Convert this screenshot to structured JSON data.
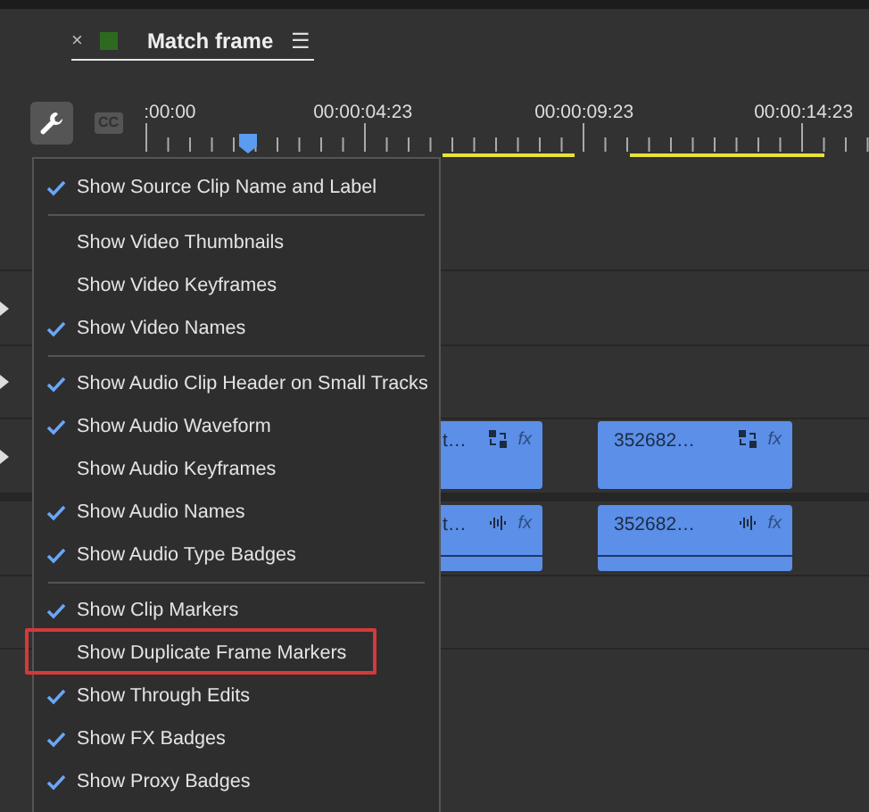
{
  "panel_tab": {
    "close": "×",
    "label": "Match frame",
    "menu": "☰",
    "selected": true,
    "color": "#2d6a1e"
  },
  "toolbar": {
    "captions": "CC"
  },
  "ruler": {
    "timecodes": [
      ":00:00",
      "00:00:04:23",
      "00:00:09:23",
      "00:00:14:23"
    ]
  },
  "video_clips": [
    {
      "name": "t…",
      "fx": "fx"
    },
    {
      "name": "352682…",
      "fx": "fx"
    }
  ],
  "audio_clips": [
    {
      "name": "t…",
      "fx": "fx"
    },
    {
      "name": "352682…",
      "fx": "fx"
    }
  ],
  "menu": {
    "groups": [
      [
        {
          "label": "Show Source Clip Name and Label",
          "checked": true,
          "highlighted": false
        }
      ],
      [
        {
          "label": "Show Video Thumbnails",
          "checked": false,
          "highlighted": false
        },
        {
          "label": "Show Video Keyframes",
          "checked": false,
          "highlighted": false
        },
        {
          "label": "Show Video Names",
          "checked": true,
          "highlighted": false
        }
      ],
      [
        {
          "label": "Show Audio Clip Header on Small Tracks",
          "checked": true,
          "highlighted": false
        },
        {
          "label": "Show Audio Waveform",
          "checked": true,
          "highlighted": false
        },
        {
          "label": "Show Audio Keyframes",
          "checked": false,
          "highlighted": false
        },
        {
          "label": "Show Audio Names",
          "checked": true,
          "highlighted": false
        },
        {
          "label": "Show Audio Type Badges",
          "checked": true,
          "highlighted": false
        }
      ],
      [
        {
          "label": "Show Clip Markers",
          "checked": true,
          "highlighted": false
        },
        {
          "label": "Show Duplicate Frame Markers",
          "checked": false,
          "highlighted": true
        },
        {
          "label": "Show Through Edits",
          "checked": true,
          "highlighted": false
        },
        {
          "label": "Show FX Badges",
          "checked": true,
          "highlighted": false
        },
        {
          "label": "Show Proxy Badges",
          "checked": true,
          "highlighted": false
        }
      ]
    ]
  }
}
